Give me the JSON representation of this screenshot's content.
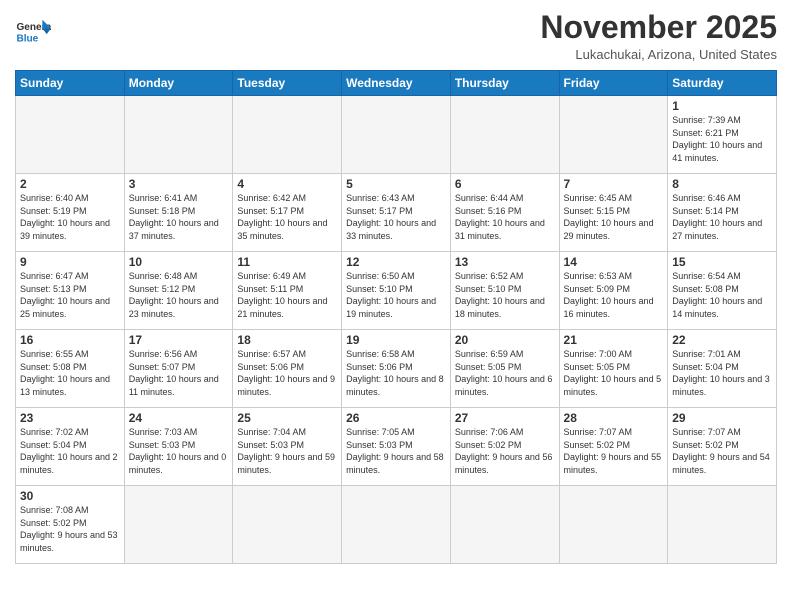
{
  "header": {
    "logo_general": "General",
    "logo_blue": "Blue",
    "month_title": "November 2025",
    "location": "Lukachukai, Arizona, United States"
  },
  "days_of_week": [
    "Sunday",
    "Monday",
    "Tuesday",
    "Wednesday",
    "Thursday",
    "Friday",
    "Saturday"
  ],
  "weeks": [
    [
      {
        "day": "",
        "empty": true
      },
      {
        "day": "",
        "empty": true
      },
      {
        "day": "",
        "empty": true
      },
      {
        "day": "",
        "empty": true
      },
      {
        "day": "",
        "empty": true
      },
      {
        "day": "",
        "empty": true
      },
      {
        "day": "1",
        "sunrise": "7:39 AM",
        "sunset": "6:21 PM",
        "daylight": "10 hours and 41 minutes."
      }
    ],
    [
      {
        "day": "2",
        "sunrise": "6:40 AM",
        "sunset": "5:19 PM",
        "daylight": "10 hours and 39 minutes."
      },
      {
        "day": "3",
        "sunrise": "6:41 AM",
        "sunset": "5:18 PM",
        "daylight": "10 hours and 37 minutes."
      },
      {
        "day": "4",
        "sunrise": "6:42 AM",
        "sunset": "5:17 PM",
        "daylight": "10 hours and 35 minutes."
      },
      {
        "day": "5",
        "sunrise": "6:43 AM",
        "sunset": "5:17 PM",
        "daylight": "10 hours and 33 minutes."
      },
      {
        "day": "6",
        "sunrise": "6:44 AM",
        "sunset": "5:16 PM",
        "daylight": "10 hours and 31 minutes."
      },
      {
        "day": "7",
        "sunrise": "6:45 AM",
        "sunset": "5:15 PM",
        "daylight": "10 hours and 29 minutes."
      },
      {
        "day": "8",
        "sunrise": "6:46 AM",
        "sunset": "5:14 PM",
        "daylight": "10 hours and 27 minutes."
      }
    ],
    [
      {
        "day": "9",
        "sunrise": "6:47 AM",
        "sunset": "5:13 PM",
        "daylight": "10 hours and 25 minutes."
      },
      {
        "day": "10",
        "sunrise": "6:48 AM",
        "sunset": "5:12 PM",
        "daylight": "10 hours and 23 minutes."
      },
      {
        "day": "11",
        "sunrise": "6:49 AM",
        "sunset": "5:11 PM",
        "daylight": "10 hours and 21 minutes."
      },
      {
        "day": "12",
        "sunrise": "6:50 AM",
        "sunset": "5:10 PM",
        "daylight": "10 hours and 19 minutes."
      },
      {
        "day": "13",
        "sunrise": "6:52 AM",
        "sunset": "5:10 PM",
        "daylight": "10 hours and 18 minutes."
      },
      {
        "day": "14",
        "sunrise": "6:53 AM",
        "sunset": "5:09 PM",
        "daylight": "10 hours and 16 minutes."
      },
      {
        "day": "15",
        "sunrise": "6:54 AM",
        "sunset": "5:08 PM",
        "daylight": "10 hours and 14 minutes."
      }
    ],
    [
      {
        "day": "16",
        "sunrise": "6:55 AM",
        "sunset": "5:08 PM",
        "daylight": "10 hours and 13 minutes."
      },
      {
        "day": "17",
        "sunrise": "6:56 AM",
        "sunset": "5:07 PM",
        "daylight": "10 hours and 11 minutes."
      },
      {
        "day": "18",
        "sunrise": "6:57 AM",
        "sunset": "5:06 PM",
        "daylight": "10 hours and 9 minutes."
      },
      {
        "day": "19",
        "sunrise": "6:58 AM",
        "sunset": "5:06 PM",
        "daylight": "10 hours and 8 minutes."
      },
      {
        "day": "20",
        "sunrise": "6:59 AM",
        "sunset": "5:05 PM",
        "daylight": "10 hours and 6 minutes."
      },
      {
        "day": "21",
        "sunrise": "7:00 AM",
        "sunset": "5:05 PM",
        "daylight": "10 hours and 5 minutes."
      },
      {
        "day": "22",
        "sunrise": "7:01 AM",
        "sunset": "5:04 PM",
        "daylight": "10 hours and 3 minutes."
      }
    ],
    [
      {
        "day": "23",
        "sunrise": "7:02 AM",
        "sunset": "5:04 PM",
        "daylight": "10 hours and 2 minutes."
      },
      {
        "day": "24",
        "sunrise": "7:03 AM",
        "sunset": "5:03 PM",
        "daylight": "10 hours and 0 minutes."
      },
      {
        "day": "25",
        "sunrise": "7:04 AM",
        "sunset": "5:03 PM",
        "daylight": "9 hours and 59 minutes."
      },
      {
        "day": "26",
        "sunrise": "7:05 AM",
        "sunset": "5:03 PM",
        "daylight": "9 hours and 58 minutes."
      },
      {
        "day": "27",
        "sunrise": "7:06 AM",
        "sunset": "5:02 PM",
        "daylight": "9 hours and 56 minutes."
      },
      {
        "day": "28",
        "sunrise": "7:07 AM",
        "sunset": "5:02 PM",
        "daylight": "9 hours and 55 minutes."
      },
      {
        "day": "29",
        "sunrise": "7:07 AM",
        "sunset": "5:02 PM",
        "daylight": "9 hours and 54 minutes."
      }
    ],
    [
      {
        "day": "30",
        "sunrise": "7:08 AM",
        "sunset": "5:02 PM",
        "daylight": "9 hours and 53 minutes."
      },
      {
        "day": "",
        "empty": true
      },
      {
        "day": "",
        "empty": true
      },
      {
        "day": "",
        "empty": true
      },
      {
        "day": "",
        "empty": true
      },
      {
        "day": "",
        "empty": true
      },
      {
        "day": "",
        "empty": true
      }
    ]
  ]
}
